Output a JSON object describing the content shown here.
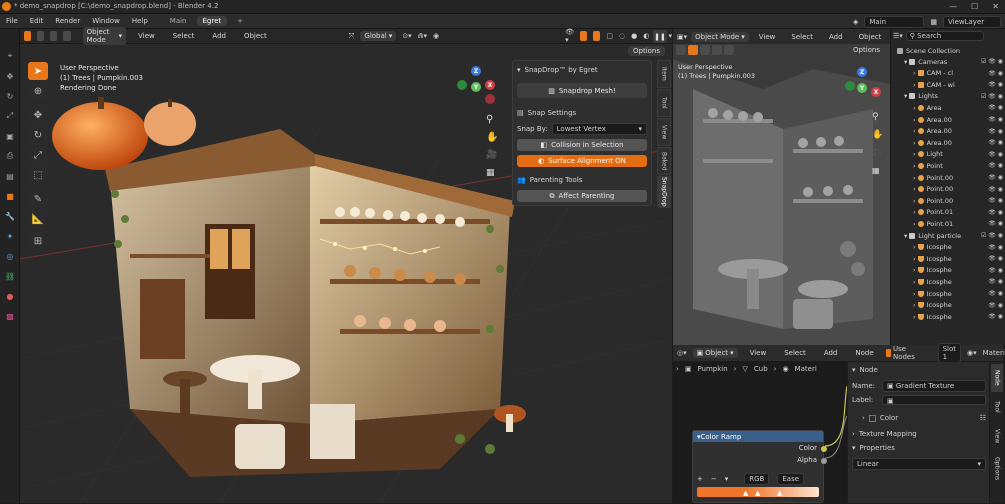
{
  "window": {
    "title": "* demo_snapdrop [C:\\demo_snapdrop.blend] - Blender 4.2",
    "controls": [
      "—",
      "☐",
      "✕"
    ]
  },
  "menu": {
    "items": [
      "File",
      "Edit",
      "Render",
      "Window",
      "Help"
    ],
    "workspaces": [
      "Main",
      "Egret"
    ],
    "active_workspace": "Egret",
    "add_tab": "+",
    "scene": "Main",
    "view_layer": "ViewLayer"
  },
  "viewport": {
    "mode": "Object Mode",
    "menus": [
      "View",
      "Select",
      "Add",
      "Object"
    ],
    "transform": "Global",
    "options": "Options",
    "info_line1": "User Perspective",
    "info_line2": "(1) Trees | Pumpkin.003",
    "info_line3": "Rendering Done"
  },
  "snapdrop": {
    "header": "SnapDrop™ by Egret",
    "snap_mesh": "Snapdrop Mesh!",
    "snap_settings": "Snap Settings",
    "snap_by_label": "Snap By:",
    "snap_by_value": "Lowest Vertex",
    "collision": "Collision in Selection",
    "surface": "Surface Alignment ON",
    "parenting": "Parenting Tools",
    "affect_parenting": "Affect Parenting",
    "tabs": [
      "Item",
      "Tool",
      "View",
      "Baked",
      "SnapDrop"
    ]
  },
  "viewport2": {
    "mode": "Object Mode",
    "menus": [
      "View",
      "Select",
      "Add",
      "Object"
    ],
    "options": "Options",
    "info_line1": "User Perspective",
    "info_line2": "(1) Trees | Pumpkin.003"
  },
  "outliner": {
    "search": "Search",
    "root": "Scene Collection",
    "rows": [
      {
        "label": "Cameras",
        "depth": 1,
        "kind": "collection"
      },
      {
        "label": "CAM - cl",
        "depth": 2,
        "kind": "camera"
      },
      {
        "label": "CAM - wi",
        "depth": 2,
        "kind": "camera"
      },
      {
        "label": "Lights",
        "depth": 1,
        "kind": "collection"
      },
      {
        "label": "Area",
        "depth": 2,
        "kind": "light"
      },
      {
        "label": "Area.00",
        "depth": 2,
        "kind": "light"
      },
      {
        "label": "Area.00",
        "depth": 2,
        "kind": "light"
      },
      {
        "label": "Area.00",
        "depth": 2,
        "kind": "light"
      },
      {
        "label": "Light",
        "depth": 2,
        "kind": "light"
      },
      {
        "label": "Point",
        "depth": 2,
        "kind": "light"
      },
      {
        "label": "Point.00",
        "depth": 2,
        "kind": "light"
      },
      {
        "label": "Point.00",
        "depth": 2,
        "kind": "light"
      },
      {
        "label": "Point.00",
        "depth": 2,
        "kind": "light"
      },
      {
        "label": "Point.01",
        "depth": 2,
        "kind": "light"
      },
      {
        "label": "Point.01",
        "depth": 2,
        "kind": "light"
      },
      {
        "label": "Light particle",
        "depth": 1,
        "kind": "collection"
      },
      {
        "label": "Icosphe",
        "depth": 2,
        "kind": "mesh"
      },
      {
        "label": "Icosphe",
        "depth": 2,
        "kind": "mesh"
      },
      {
        "label": "Icosphe",
        "depth": 2,
        "kind": "mesh"
      },
      {
        "label": "Icosphe",
        "depth": 2,
        "kind": "mesh"
      },
      {
        "label": "Icosphe",
        "depth": 2,
        "kind": "mesh"
      },
      {
        "label": "Icosphe",
        "depth": 2,
        "kind": "mesh"
      },
      {
        "label": "Icosphe",
        "depth": 2,
        "kind": "mesh"
      }
    ]
  },
  "node_editor": {
    "type": "Object",
    "menus": [
      "View",
      "Select",
      "Add",
      "Node"
    ],
    "use_nodes": "Use Nodes",
    "slot": "Slot 1",
    "material": "Materi",
    "crumbs": [
      "Pumpkin",
      "Cub",
      "Materi"
    ],
    "color_ramp": {
      "title": "Color Ramp",
      "out_color": "Color",
      "out_alpha": "Alpha",
      "mode": "RGB",
      "interp": "Ease",
      "plus": "+",
      "minus": "−",
      "ramp_from": "#f0742a",
      "ramp_to": "#fde3cf"
    }
  },
  "node_panel": {
    "section": "Node",
    "name_label": "Name:",
    "name_value": "Gradient Texture",
    "label_label": "Label:",
    "color": "Color",
    "texture_mapping": "Texture Mapping",
    "properties": "Properties",
    "interp": "Linear",
    "tabs": [
      "Node",
      "Tool",
      "View",
      "Options"
    ]
  },
  "colors": {
    "accent": "#e8771b",
    "blue_header": "#3a5f8a"
  }
}
